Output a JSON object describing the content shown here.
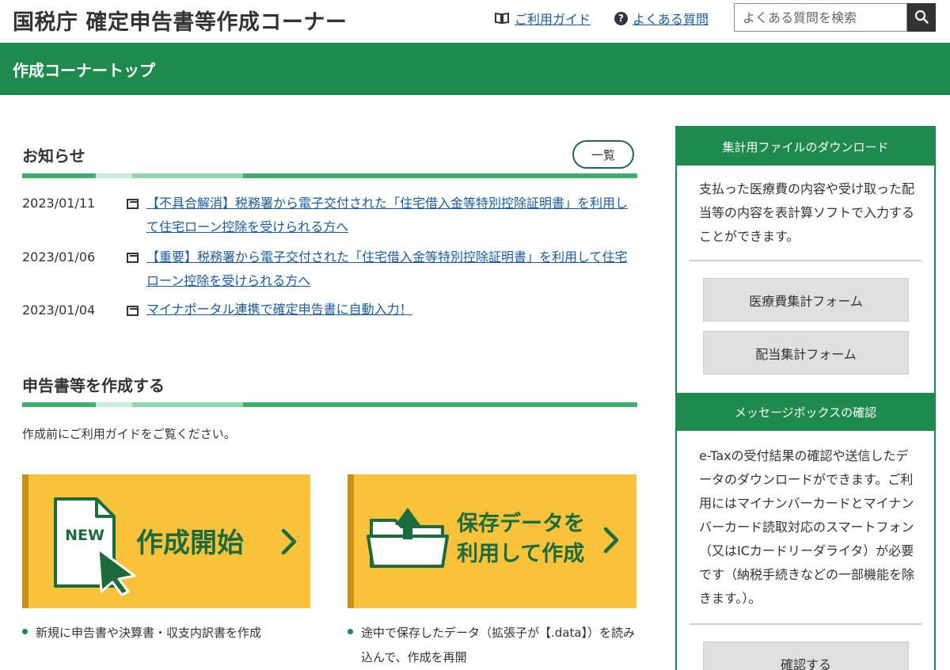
{
  "header": {
    "site_title": "国税庁 確定申告書等作成コーナー",
    "guide_link": "ご利用ガイド",
    "faq_link": "よくある質問",
    "search_placeholder": "よくある質問を検索"
  },
  "banner": {
    "title": "作成コーナートップ"
  },
  "news": {
    "title": "お知らせ",
    "all_button": "一覧",
    "items": [
      {
        "date": "2023/01/11",
        "text": "【不具合解消】税務署から電子交付された「住宅借入金等特別控除証明書」を利用して住宅ローン控除を受けられる方へ"
      },
      {
        "date": "2023/01/06",
        "text": "【重要】税務署から電子交付された「住宅借入金等特別控除証明書」を利用して住宅ローン控除を受けられる方へ"
      },
      {
        "date": "2023/01/04",
        "text": "マイナポータル連携で確定申告書に自動入力！"
      }
    ]
  },
  "create": {
    "title": "申告書等を作成する",
    "intro": "作成前にご利用ガイドをご覧ください。",
    "start_card": {
      "badge": "NEW",
      "label": "作成開始",
      "note": "新規に申告書や決算書・収支内訳書を作成"
    },
    "saved_card": {
      "label_line1": "保存データを",
      "label_line2": "利用して作成",
      "note": "途中で保存したデータ（拡張子が【.data】）を読み込んで、作成を再開"
    }
  },
  "sidebar": {
    "download": {
      "title": "集計用ファイルのダウンロード",
      "text": "支払った医療費の内容や受け取った配当等の内容を表計算ソフトで入力することができます。",
      "buttons": [
        "医療費集計フォーム",
        "配当集計フォーム"
      ]
    },
    "messagebox": {
      "title": "メッセージボックスの確認",
      "text": "e-Taxの受付結果の確認や送信したデータのダウンロードができます。ご利用にはマイナンバーカードとマイナンバーカード読取対応のスマートフォン（又はICカードリーダライタ）が必要です（納税手続きなどの一部機能を除きます。）。",
      "button": "確認する"
    }
  },
  "colors": {
    "brand_green": "#1e8a4e",
    "card_yellow": "#f8c23a",
    "card_text_green": "#1b6b3d",
    "link_blue": "#1a5a9e"
  }
}
